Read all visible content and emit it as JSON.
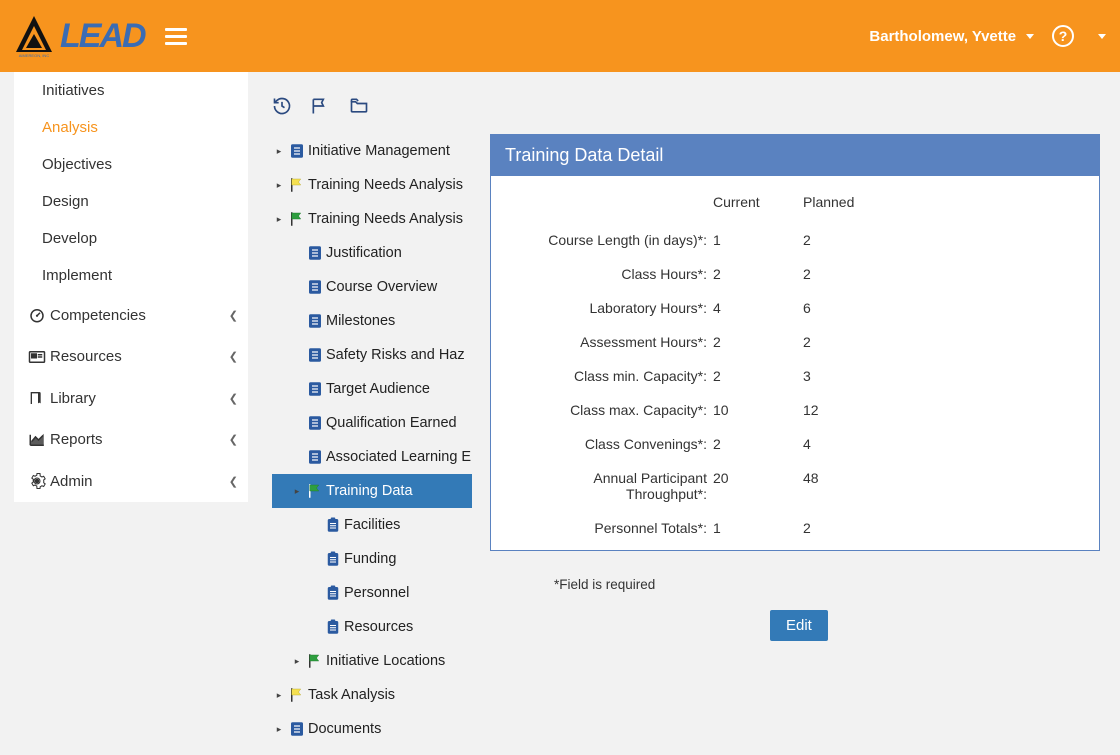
{
  "header": {
    "brand_text": "LEAD",
    "user_name": "Bartholomew, Yvette",
    "company_sub": "AIMEREON, INC"
  },
  "sidebar": {
    "subitems": [
      {
        "label": "Initiatives",
        "active": false
      },
      {
        "label": "Analysis",
        "active": true
      },
      {
        "label": "Objectives",
        "active": false
      },
      {
        "label": "Design",
        "active": false
      },
      {
        "label": "Develop",
        "active": false
      },
      {
        "label": "Implement",
        "active": false
      }
    ],
    "sections": [
      {
        "label": "Competencies",
        "icon": "dashboard"
      },
      {
        "label": "Resources",
        "icon": "card"
      },
      {
        "label": "Library",
        "icon": "book"
      },
      {
        "label": "Reports",
        "icon": "chart"
      },
      {
        "label": "Admin",
        "icon": "gear"
      }
    ]
  },
  "tree": [
    {
      "label": "Initiative Management",
      "indent": 0,
      "icon": "doc",
      "arrow": true
    },
    {
      "label": "Training Needs Analysis",
      "indent": 0,
      "icon": "flag-y",
      "arrow": true
    },
    {
      "label": "Training Needs Analysis",
      "indent": 0,
      "icon": "flag-g",
      "arrow": true
    },
    {
      "label": "Justification",
      "indent": 1,
      "icon": "doc",
      "arrow": false
    },
    {
      "label": "Course Overview",
      "indent": 1,
      "icon": "doc",
      "arrow": false
    },
    {
      "label": "Milestones",
      "indent": 1,
      "icon": "doc",
      "arrow": false
    },
    {
      "label": "Safety Risks and Haz",
      "indent": 1,
      "icon": "doc",
      "arrow": false
    },
    {
      "label": "Target Audience",
      "indent": 1,
      "icon": "doc",
      "arrow": false
    },
    {
      "label": "Qualification Earned",
      "indent": 1,
      "icon": "doc",
      "arrow": false
    },
    {
      "label": "Associated Learning E",
      "indent": 1,
      "icon": "doc",
      "arrow": false
    },
    {
      "label": "Training Data",
      "indent": 1,
      "icon": "flag-g",
      "arrow": true,
      "selected": true
    },
    {
      "label": "Facilities",
      "indent": 2,
      "icon": "clip",
      "arrow": false
    },
    {
      "label": "Funding",
      "indent": 2,
      "icon": "clip",
      "arrow": false
    },
    {
      "label": "Personnel",
      "indent": 2,
      "icon": "clip",
      "arrow": false
    },
    {
      "label": "Resources",
      "indent": 2,
      "icon": "clip",
      "arrow": false
    },
    {
      "label": "Initiative Locations",
      "indent": 1,
      "icon": "flag-g",
      "arrow": true
    },
    {
      "label": "Task Analysis",
      "indent": 0,
      "icon": "flag-y",
      "arrow": true
    },
    {
      "label": "Documents",
      "indent": 0,
      "icon": "doc",
      "arrow": true
    }
  ],
  "detail": {
    "title": "Training Data Detail",
    "col_current": "Current",
    "col_planned": "Planned",
    "rows": [
      {
        "label": "Course Length (in days)*:",
        "current": "1",
        "planned": "2"
      },
      {
        "label": "Class Hours*:",
        "current": "2",
        "planned": "2"
      },
      {
        "label": "Laboratory Hours*:",
        "current": "4",
        "planned": "6"
      },
      {
        "label": "Assessment Hours*:",
        "current": "2",
        "planned": "2"
      },
      {
        "label": "Class min. Capacity*:",
        "current": "2",
        "planned": "3"
      },
      {
        "label": "Class max. Capacity*:",
        "current": "10",
        "planned": "12"
      },
      {
        "label": "Class Convenings*:",
        "current": "2",
        "planned": "4"
      },
      {
        "label": "Annual Participant Throughput*:",
        "current": "20",
        "planned": "48"
      },
      {
        "label": "Personnel Totals*:",
        "current": "1",
        "planned": "2"
      }
    ],
    "required_note": "*Field is required",
    "edit_label": "Edit"
  }
}
